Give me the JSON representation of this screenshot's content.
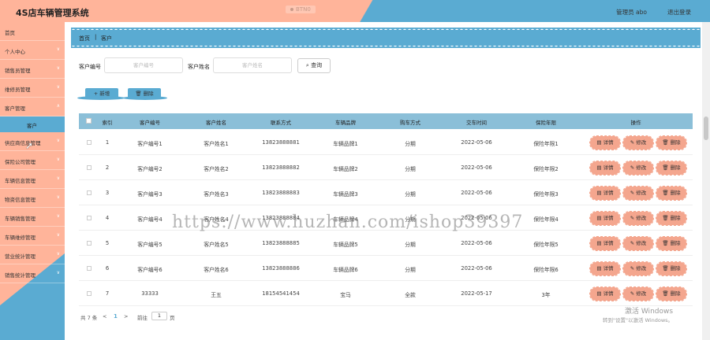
{
  "header": {
    "title": "4S店车辆管理系统",
    "status": "BTN0",
    "user": "管理员 abo",
    "logout": "退出登录"
  },
  "sidebar": {
    "items": [
      {
        "label": "首页",
        "chev": ""
      },
      {
        "label": "个人中心",
        "chev": "∨"
      },
      {
        "label": "销售员管理",
        "chev": "∨"
      },
      {
        "label": "维修员管理",
        "chev": "∨"
      },
      {
        "label": "客户管理",
        "chev": "∧"
      },
      {
        "label": "供应商信息管理",
        "chev": "∨"
      },
      {
        "label": "保险公司管理",
        "chev": "∨"
      },
      {
        "label": "车辆信息管理",
        "chev": "∨"
      },
      {
        "label": "物资信息管理",
        "chev": "∨"
      },
      {
        "label": "车辆销售管理",
        "chev": "∨"
      },
      {
        "label": "车辆维修管理",
        "chev": "∨"
      },
      {
        "label": "营业统计管理",
        "chev": "∨"
      },
      {
        "label": "销售统计管理",
        "chev": "∨"
      }
    ],
    "active_sub": "客户"
  },
  "breadcrumb": {
    "home": "首页",
    "sep": "|",
    "current": "客户"
  },
  "search": {
    "code_label": "客户编号",
    "code_placeholder": "客户编号",
    "name_label": "客户姓名",
    "name_placeholder": "客户姓名",
    "query_button": "查询"
  },
  "actions": {
    "add": "新增",
    "delete": "删除"
  },
  "table": {
    "columns": [
      "索引",
      "客户编号",
      "客户姓名",
      "联系方式",
      "车辆品牌",
      "购车方式",
      "交车时间",
      "保险年限",
      "操作"
    ],
    "rows": [
      [
        "1",
        "客户编号1",
        "客户姓名1",
        "13823888881",
        "车辆品牌1",
        "分期",
        "2022-05-06",
        "保险年限1"
      ],
      [
        "2",
        "客户编号2",
        "客户姓名2",
        "13823888882",
        "车辆品牌2",
        "分期",
        "2022-05-06",
        "保险年限2"
      ],
      [
        "3",
        "客户编号3",
        "客户姓名3",
        "13823888883",
        "车辆品牌3",
        "分期",
        "2022-05-06",
        "保险年限3"
      ],
      [
        "4",
        "客户编号4",
        "客户姓名4",
        "13823888884",
        "车辆品牌4",
        "分期",
        "2022-05-06",
        "保险年限4"
      ],
      [
        "5",
        "客户编号5",
        "客户姓名5",
        "13823888885",
        "车辆品牌5",
        "分期",
        "2022-05-06",
        "保险年限5"
      ],
      [
        "6",
        "客户编号6",
        "客户姓名6",
        "13823888886",
        "车辆品牌6",
        "分期",
        "2022-05-06",
        "保险年限6"
      ],
      [
        "7",
        "33333",
        "王五",
        "18154541454",
        "宝马",
        "全款",
        "2022-05-17",
        "3年"
      ]
    ],
    "ops": {
      "detail": "详情",
      "edit": "修改",
      "delete": "删除"
    }
  },
  "pager": {
    "total": "共 7 条",
    "prev": "<",
    "page": "1",
    "next": ">",
    "goto": "前往",
    "goto_value": "1",
    "unit": "页"
  },
  "watermark": "https://www.huzhan.com/ishop39397",
  "os_overlay": {
    "line1": "激活 Windows",
    "line2": "转到\"设置\"以激活 Windows。"
  },
  "colors": {
    "accent_blue": "#5aabd2",
    "accent_salmon": "#ffb49a",
    "op_button": "#f4a68e"
  }
}
